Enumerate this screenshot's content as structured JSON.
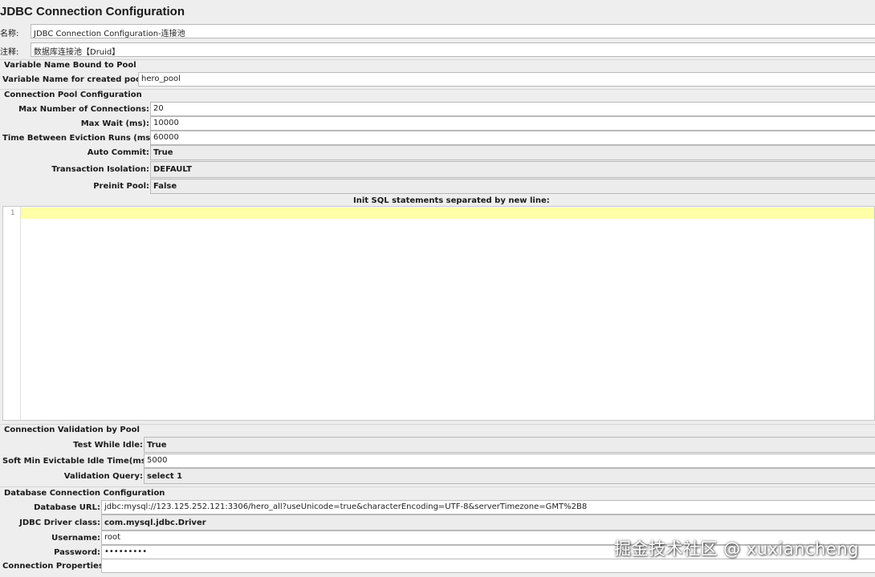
{
  "title": "JDBC Connection Configuration",
  "name_label": "名称:",
  "name_value": "JDBC Connection Configuration-连接池",
  "comment_label": "注释:",
  "comment_value": "数据库连接池【Druid】",
  "variable_section": {
    "title": "Variable Name Bound to Pool",
    "var_label": "Variable Name for created pool:",
    "var_value": "hero_pool"
  },
  "pool_section": {
    "title": "Connection Pool Configuration",
    "max_conn_label": "Max Number of Connections:",
    "max_conn_value": "20",
    "max_wait_label": "Max Wait (ms):",
    "max_wait_value": "10000",
    "eviction_label": "Time Between Eviction Runs (ms):",
    "eviction_value": "60000",
    "auto_commit_label": "Auto Commit:",
    "auto_commit_value": "True",
    "isolation_label": "Transaction Isolation:",
    "isolation_value": "DEFAULT",
    "preinit_label": "Preinit Pool:",
    "preinit_value": "False",
    "init_sql_label": "Init SQL statements separated by new line:",
    "init_sql_line_number": "1"
  },
  "validation_section": {
    "title": "Connection Validation by Pool",
    "test_idle_label": "Test While Idle:",
    "test_idle_value": "True",
    "soft_min_label": "Soft Min Evictable Idle Time(ms):",
    "soft_min_value": "5000",
    "validation_query_label": "Validation Query:",
    "validation_query_value": "select 1"
  },
  "db_section": {
    "title": "Database Connection Configuration",
    "url_label": "Database URL:",
    "url_value": "jdbc:mysql://123.125.252.121:3306/hero_all?useUnicode=true&characterEncoding=UTF-8&serverTimezone=GMT%2B8",
    "driver_label": "JDBC Driver class:",
    "driver_value": "com.mysql.jdbc.Driver",
    "username_label": "Username:",
    "username_value": "root",
    "password_label": "Password:",
    "password_value": "•••••••••",
    "props_label": "Connection Properties:",
    "props_value": ""
  },
  "watermark": "掘金技术社区 @ xuxiancheng"
}
